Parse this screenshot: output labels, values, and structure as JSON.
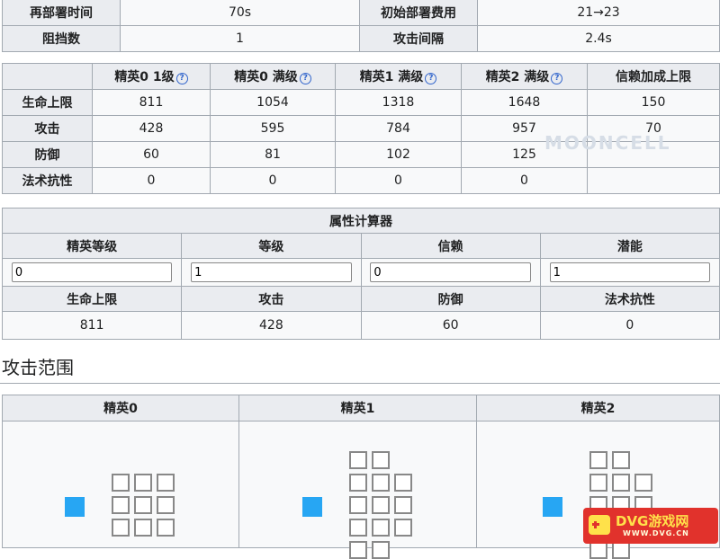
{
  "info": {
    "redeploy_label": "再部署时间",
    "redeploy_value": "70s",
    "cost_label": "初始部署费用",
    "cost_value": "21→23",
    "block_label": "阻挡数",
    "block_value": "1",
    "interval_label": "攻击间隔",
    "interval_value": "2.4s"
  },
  "stats": {
    "headers": [
      "精英0 1级",
      "精英0 满级",
      "精英1 满级",
      "精英2 满级",
      "信赖加成上限"
    ],
    "help_glyph": "?",
    "rows": [
      {
        "label": "生命上限",
        "values": [
          "811",
          "1054",
          "1318",
          "1648"
        ],
        "trust": "150"
      },
      {
        "label": "攻击",
        "values": [
          "428",
          "595",
          "784",
          "957"
        ],
        "trust": "70"
      },
      {
        "label": "防御",
        "values": [
          "60",
          "81",
          "102",
          "125"
        ],
        "trust": ""
      },
      {
        "label": "法术抗性",
        "values": [
          "0",
          "0",
          "0",
          "0"
        ],
        "trust": ""
      }
    ]
  },
  "calculator": {
    "title": "属性计算器",
    "input_labels": [
      "精英等级",
      "等级",
      "信赖",
      "潜能"
    ],
    "input_values": [
      "0",
      "1",
      "0",
      "1"
    ],
    "result_labels": [
      "生命上限",
      "攻击",
      "防御",
      "法术抗性"
    ],
    "result_values": [
      "811",
      "428",
      "60",
      "0"
    ]
  },
  "range": {
    "heading": "攻击范围",
    "stages": [
      "精英0",
      "精英1",
      "精英2"
    ]
  },
  "watermark": "MOONCELL",
  "badge": {
    "title": "DVG游戏网",
    "sub": "WWW.DVG.CN"
  },
  "colors": {
    "self_tile": "#27a6f3",
    "header_bg": "#eaecf0",
    "cell_bg": "#f8f9fa",
    "border": "#a2a9b1"
  }
}
